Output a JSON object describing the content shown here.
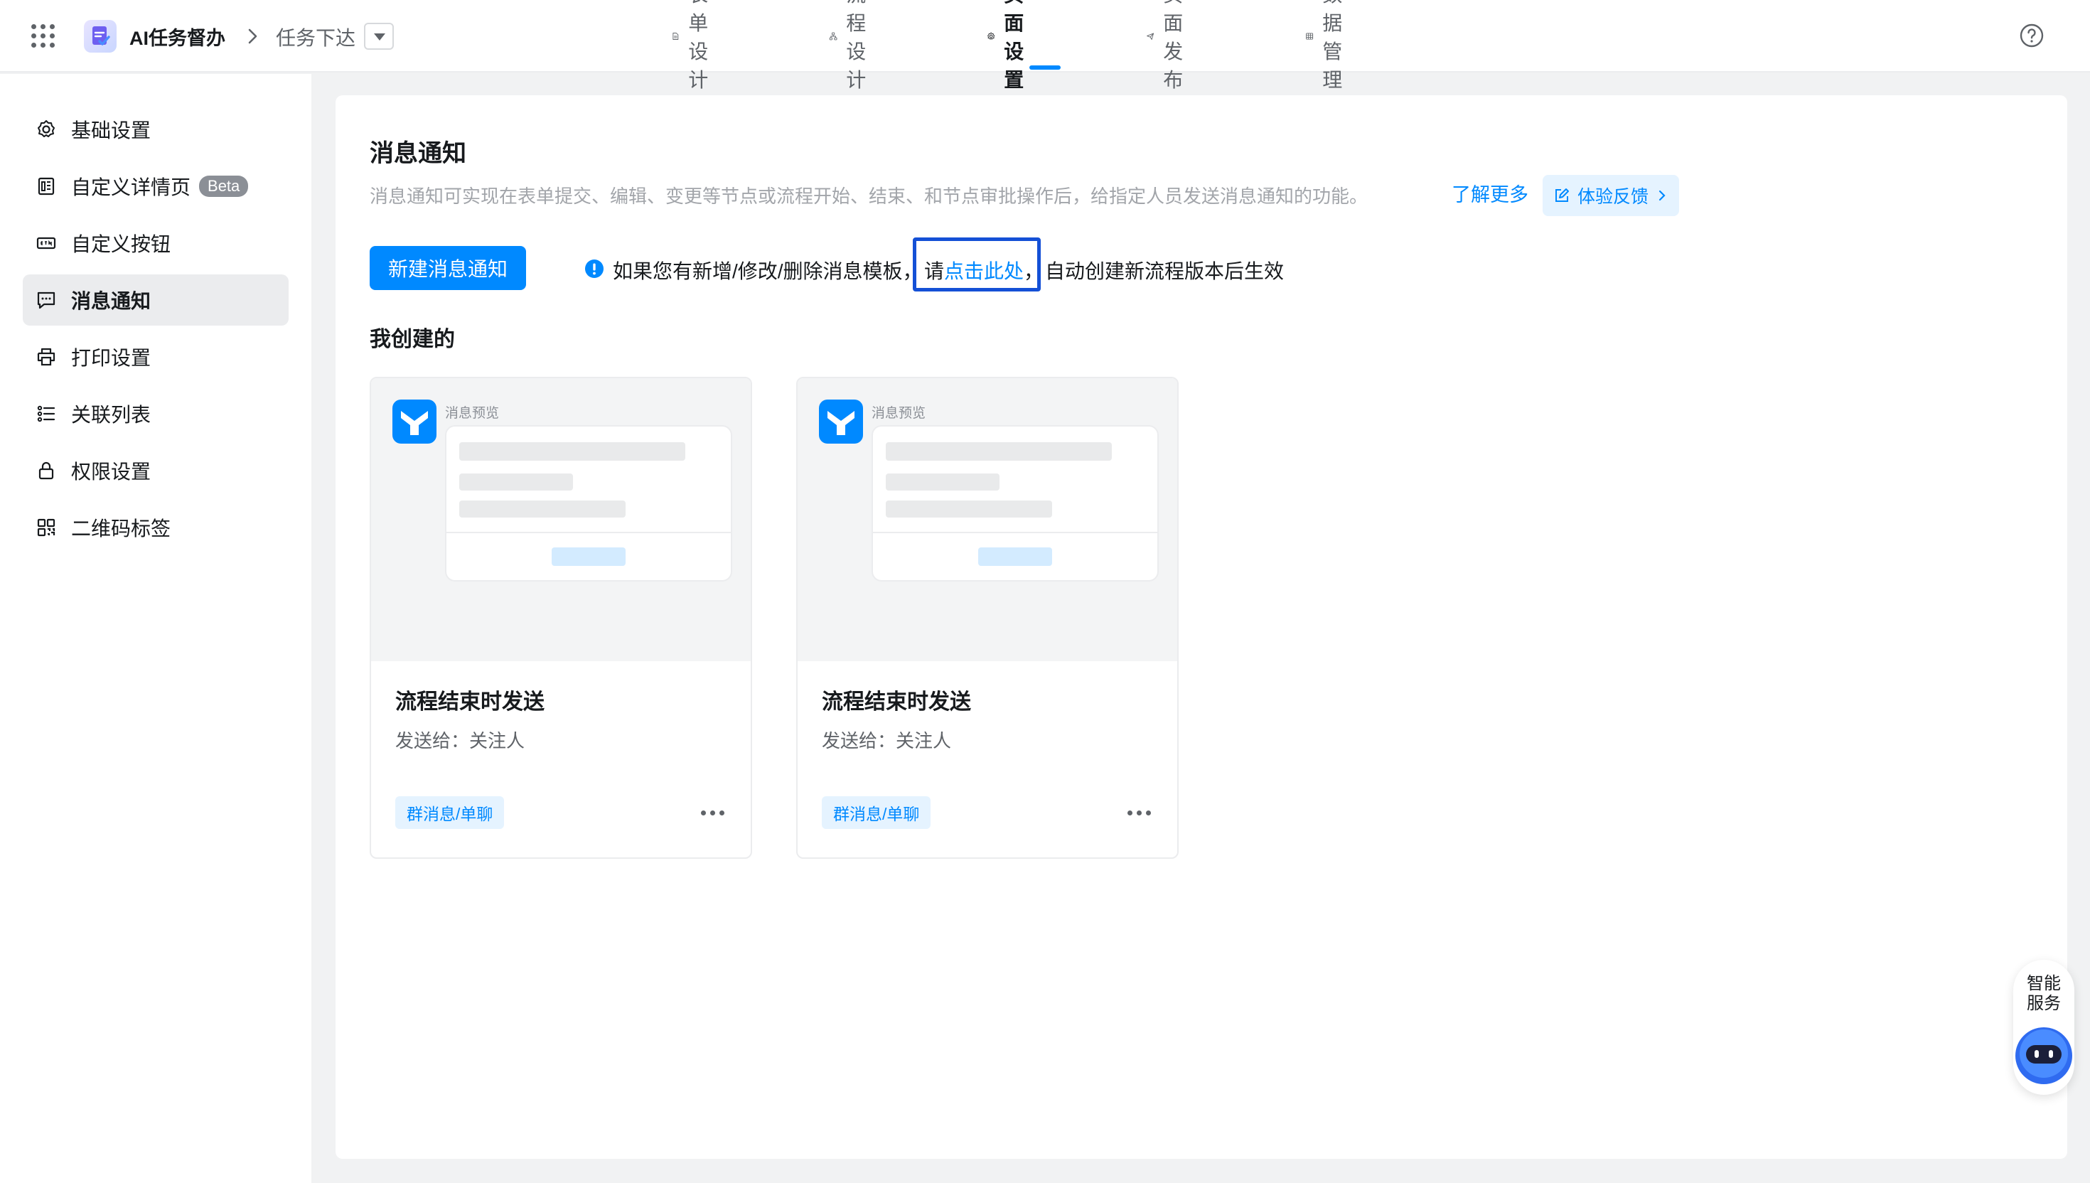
{
  "header": {
    "app_title": "AI任务督办",
    "breadcrumb_item": "任务下达",
    "tabs": [
      {
        "label": "表单设计",
        "icon": "document-icon"
      },
      {
        "label": "流程设计",
        "icon": "flow-icon"
      },
      {
        "label": "页面设置",
        "icon": "gear-icon",
        "active": true
      },
      {
        "label": "页面发布",
        "icon": "send-icon"
      },
      {
        "label": "数据管理",
        "icon": "table-icon"
      }
    ]
  },
  "sidebar": {
    "items": [
      {
        "label": "基础设置",
        "icon": "gear-icon"
      },
      {
        "label": "自定义详情页",
        "icon": "layout-icon",
        "badge": "Beta"
      },
      {
        "label": "自定义按钮",
        "icon": "button-icon"
      },
      {
        "label": "消息通知",
        "icon": "message-icon",
        "active": true
      },
      {
        "label": "打印设置",
        "icon": "printer-icon"
      },
      {
        "label": "关联列表",
        "icon": "list-icon"
      },
      {
        "label": "权限设置",
        "icon": "lock-icon"
      },
      {
        "label": "二维码标签",
        "icon": "qrcode-icon"
      }
    ]
  },
  "main": {
    "title": "消息通知",
    "description": "消息通知可实现在表单提交、编辑、变更等节点或流程开始、结束、和节点审批操作后，给指定人员发送消息通知的功能。",
    "learn_more": "了解更多",
    "feedback": "体验反馈",
    "new_button": "新建消息通知",
    "notice": {
      "pre": "如果您有新增/修改/删除消息模板，",
      "link_prefix": "请",
      "link": "点击此处",
      "link_suffix": "，",
      "post": "自动创建新流程版本后生效"
    },
    "section_title": "我创建的",
    "cards": [
      {
        "preview_label": "消息预览",
        "title": "流程结束时发送",
        "subtitle": "发送给：关注人",
        "tag": "群消息/单聊"
      },
      {
        "preview_label": "消息预览",
        "title": "流程结束时发送",
        "subtitle": "发送给：关注人",
        "tag": "群消息/单聊"
      }
    ]
  },
  "service": {
    "label": "智能\n服务"
  },
  "colors": {
    "accent": "#0089ff",
    "highlight_border": "#1450d6",
    "sidebar_active": "#ebecee"
  }
}
